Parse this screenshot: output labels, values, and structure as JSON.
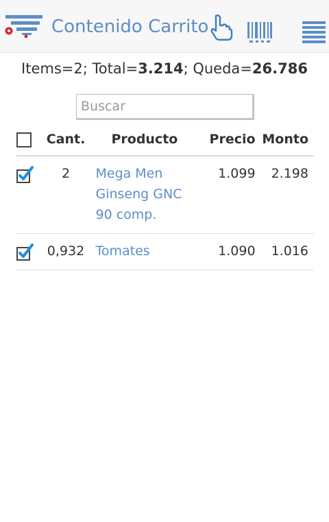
{
  "header": {
    "title": "Contenido Carrito",
    "icons": [
      "cart-logo-icon",
      "touch-hand-icon",
      "barcode-icon",
      "menu-icon"
    ],
    "accent_color": "#5b8ec9"
  },
  "summary": {
    "items_label": "Items=2; Total=",
    "total": "3.214",
    "remaining_label": "; Queda=",
    "remaining": "26.786"
  },
  "search": {
    "placeholder": "Buscar",
    "value": ""
  },
  "table": {
    "columns": [
      "Cant.",
      "Producto",
      "Precio",
      "Monto"
    ],
    "rows": [
      {
        "checked": true,
        "qty": "2",
        "product": "Mega Men Ginseng GNC 90 comp.",
        "price": "1.099",
        "amount": "2.198"
      },
      {
        "checked": true,
        "qty": "0,932",
        "product": "Tomates",
        "price": "1.090",
        "amount": "1.016"
      }
    ]
  }
}
